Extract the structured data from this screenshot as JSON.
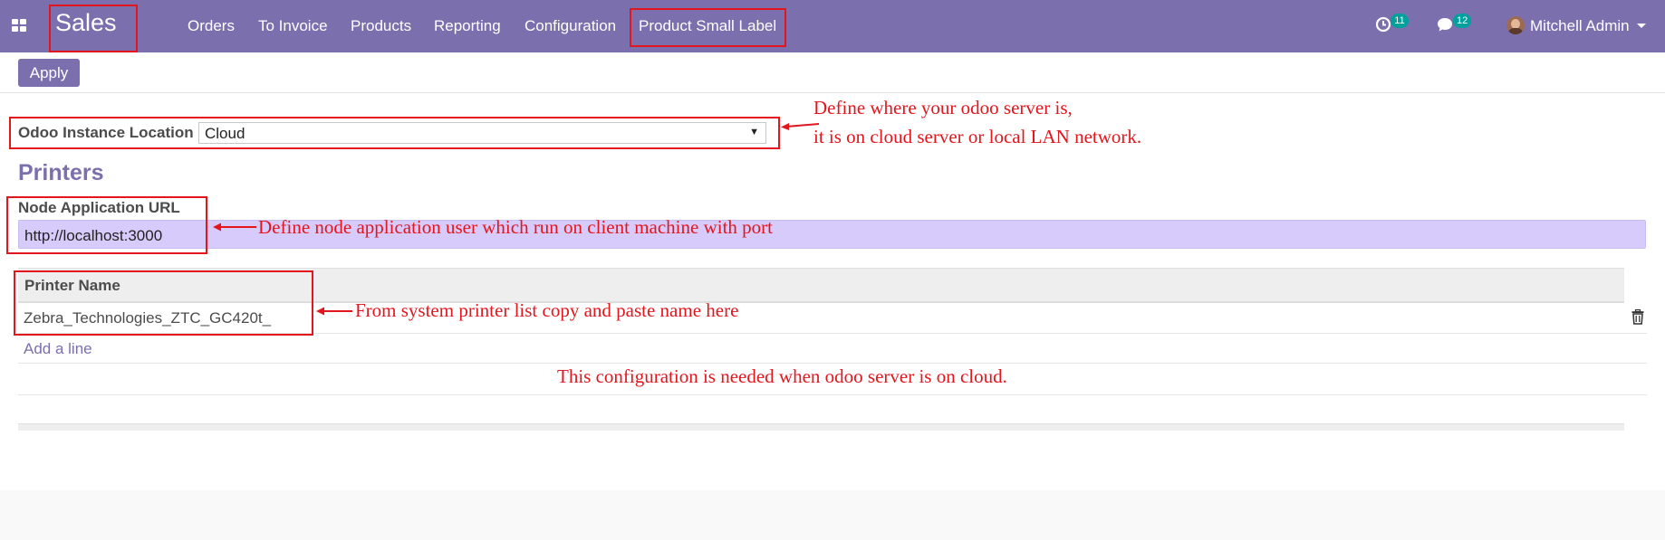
{
  "navbar": {
    "brand": "Sales",
    "menu": [
      "Orders",
      "To Invoice",
      "Products",
      "Reporting",
      "Configuration",
      "Product Small Label"
    ],
    "activity_count": "11",
    "message_count": "12",
    "user_name": "Mitchell Admin",
    "icons": [
      "apps-grid-icon",
      "clock-icon",
      "chat-bubble-icon",
      "avatar",
      "chevron-down-icon"
    ]
  },
  "control_panel": {
    "apply_label": "Apply"
  },
  "form": {
    "instance_location_label": "Odoo Instance Location",
    "instance_location_value": "Cloud",
    "printers_title": "Printers",
    "node_url_label": "Node Application URL",
    "node_url_value": "http://localhost:3000"
  },
  "printer_table": {
    "header": "Printer Name",
    "rows": [
      {
        "printer_name": "Zebra_Technologies_ZTC_GC420t_"
      }
    ],
    "add_line_label": "Add a line"
  },
  "annotations": {
    "location_note_line1": "Define where your odoo server is,",
    "location_note_line2": "it is on cloud server or local LAN network.",
    "node_note": "Define node application user which run on client machine with port",
    "printer_note": "From system printer list copy and paste name here",
    "cloud_note": "This configuration is needed when odoo server is on cloud."
  },
  "colors": {
    "brand": "#7c6fad",
    "annotation": "#e3161e",
    "badge": "#00a09d",
    "input_highlight": "#d6cbfa"
  }
}
